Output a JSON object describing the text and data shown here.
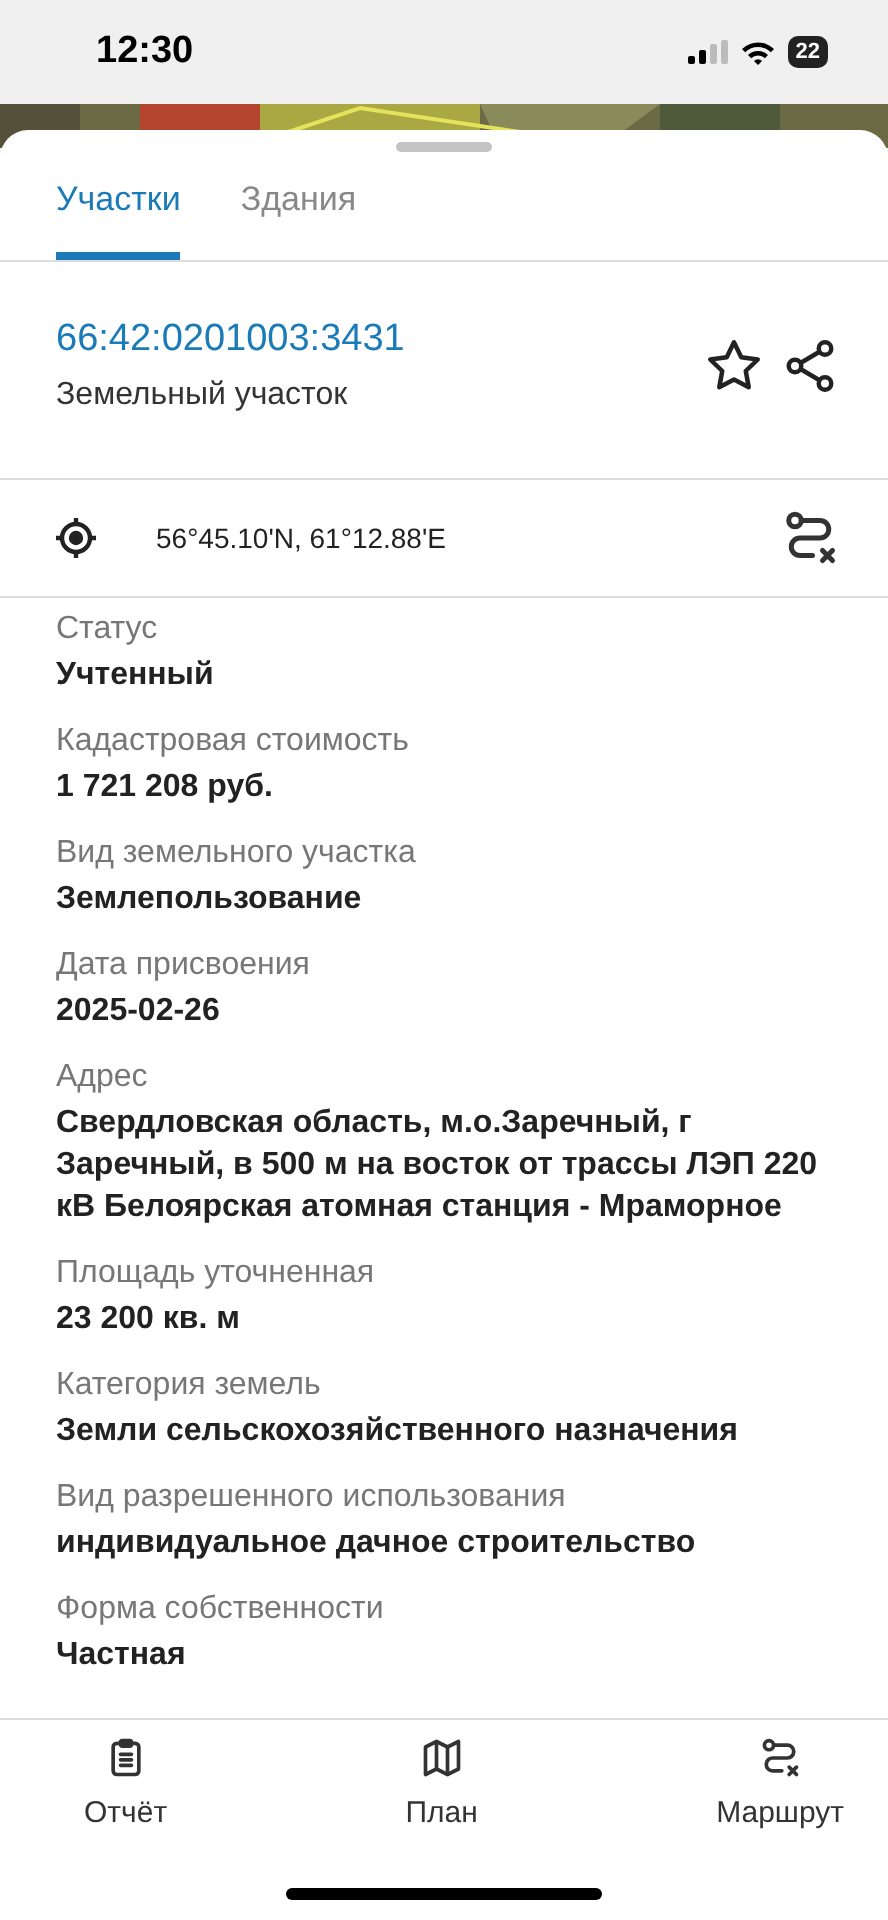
{
  "status_bar": {
    "time": "12:30",
    "battery": "22"
  },
  "tabs": [
    {
      "label": "Участки",
      "selected": true
    },
    {
      "label": "Здания",
      "selected": false
    }
  ],
  "header": {
    "number": "66:42:0201003:3431",
    "type": "Земельный участок",
    "favorite": false
  },
  "location": {
    "coords": "56°45.10'N, 61°12.88'E"
  },
  "fields": [
    {
      "label": "Статус",
      "value": "Учтенный"
    },
    {
      "label": "Кадастровая стоимость",
      "value": "1 721 208 руб."
    },
    {
      "label": "Вид земельного участка",
      "value": "Землепользование"
    },
    {
      "label": "Дата присвоения",
      "value": "2025-02-26"
    },
    {
      "label": "Адрес",
      "value": "Свердловская область, м.о.Заречный, г Заречный, в 500 м на восток от трассы ЛЭП 220 кВ Белоярская атомная станция - Мраморное"
    },
    {
      "label": "Площадь уточненная",
      "value": "23 200 кв. м"
    },
    {
      "label": "Категория земель",
      "value": "Земли сельскохозяйственного назначения"
    },
    {
      "label": "Вид разрешенного использования",
      "value": "индивидуальное дачное строительство"
    },
    {
      "label": "Форма собственности",
      "value": "Частная"
    }
  ],
  "bottom_nav": [
    {
      "kind": "report",
      "label": "Отчёт"
    },
    {
      "kind": "map",
      "label": "План"
    },
    {
      "kind": "route",
      "label": "Маршрут"
    }
  ]
}
